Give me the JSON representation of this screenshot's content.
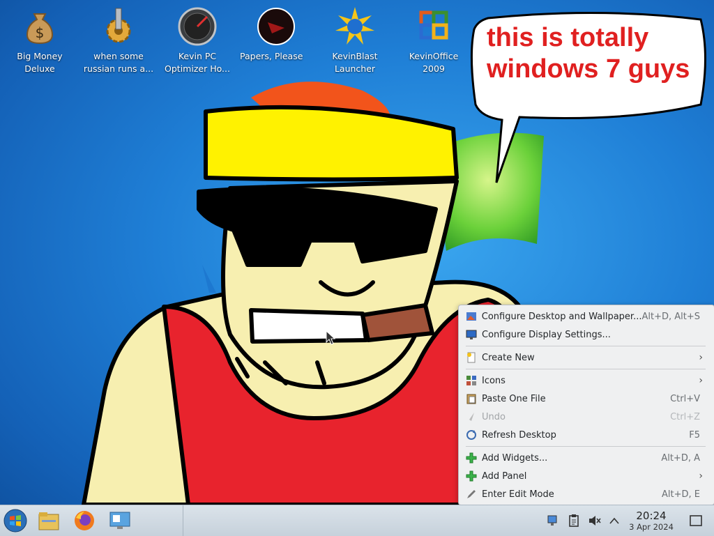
{
  "desktop": {
    "icons": [
      {
        "label": "Big Money Deluxe",
        "icon": "money-bag-icon"
      },
      {
        "label": "when some russian runs a...",
        "icon": "gear-icon"
      },
      {
        "label": "Kevin PC Optimizer Ho...",
        "icon": "gauge-icon"
      },
      {
        "label": "Papers, Please",
        "icon": "papers-please-icon"
      },
      {
        "label": "KevinBlast Launcher",
        "icon": "starburst-icon"
      },
      {
        "label": "KevinOffice 2009",
        "icon": "office-icon"
      }
    ],
    "speech_bubble": {
      "text": "this is totally windows 7 guys"
    }
  },
  "context_menu": {
    "items": [
      {
        "label": "Configure Desktop and Wallpaper...",
        "shortcut": "Alt+D, Alt+S",
        "icon": "wallpaper-settings-icon"
      },
      {
        "label": "Configure Display Settings...",
        "shortcut": "",
        "icon": "display-icon"
      },
      {
        "label": "Create New",
        "shortcut": "",
        "icon": "new-document-icon",
        "submenu": true
      },
      {
        "label": "Icons",
        "shortcut": "",
        "icon": "icons-grid-icon",
        "submenu": true
      },
      {
        "label": "Paste One File",
        "shortcut": "Ctrl+V",
        "icon": "paste-icon"
      },
      {
        "label": "Undo",
        "shortcut": "Ctrl+Z",
        "icon": "undo-icon",
        "disabled": true
      },
      {
        "label": "Refresh Desktop",
        "shortcut": "F5",
        "icon": "refresh-icon"
      },
      {
        "label": "Add Widgets...",
        "shortcut": "Alt+D, A",
        "icon": "plus-icon"
      },
      {
        "label": "Add Panel",
        "shortcut": "",
        "icon": "plus-icon",
        "submenu": true
      },
      {
        "label": "Enter Edit Mode",
        "shortcut": "Alt+D, E",
        "icon": "edit-icon"
      }
    ],
    "submenu_arrow": "›"
  },
  "taskbar": {
    "launchers": [
      "start-orb-icon",
      "file-manager-icon",
      "firefox-icon",
      "system-settings-icon"
    ],
    "tray": [
      "network-icon",
      "clipboard-icon",
      "volume-muted-icon",
      "chevron-up-icon"
    ],
    "clock": {
      "time": "20:24",
      "date": "3 Apr 2024"
    }
  }
}
